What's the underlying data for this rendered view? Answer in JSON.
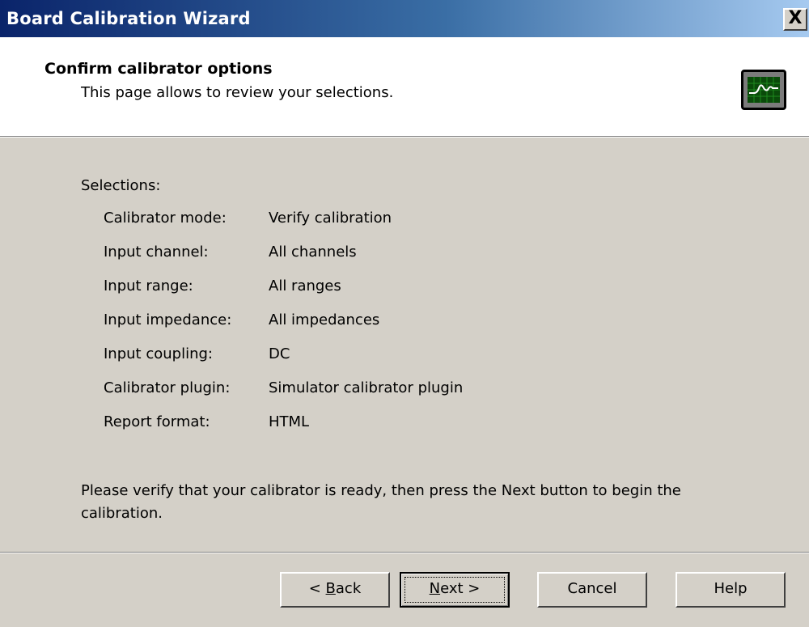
{
  "window": {
    "title": "Board Calibration Wizard",
    "close_glyph": "X"
  },
  "header": {
    "title": "Confirm calibrator options",
    "subtitle": "This page allows to review your selections.",
    "icon": "oscilloscope-icon",
    "icon_colors": {
      "screen": "#0a4a0a",
      "grid": "#1f8a1f",
      "trace": "#ffffff",
      "frame": "#7b7b7b"
    }
  },
  "selections": {
    "label": "Selections:",
    "rows": [
      {
        "name": "Calibrator mode:",
        "value": "Verify calibration"
      },
      {
        "name": "Input channel:",
        "value": "All channels"
      },
      {
        "name": "Input range:",
        "value": "All ranges"
      },
      {
        "name": "Input impedance:",
        "value": "All impedances"
      },
      {
        "name": "Input coupling:",
        "value": "DC"
      },
      {
        "name": "Calibrator plugin:",
        "value": "Simulator calibrator plugin"
      },
      {
        "name": "Report format:",
        "value": "HTML"
      }
    ]
  },
  "verify_text": "Please verify that your calibrator is ready, then press the Next button to begin the calibration.",
  "buttons": {
    "back": {
      "pre": "< ",
      "accel": "B",
      "post": "ack"
    },
    "next": {
      "pre": "",
      "accel": "N",
      "post": "ext >"
    },
    "cancel": "Cancel",
    "help": "Help"
  },
  "colors": {
    "dialog_face": "#d4d0c8",
    "title_gradient_start": "#0a246a",
    "title_gradient_end": "#a6caf0"
  }
}
